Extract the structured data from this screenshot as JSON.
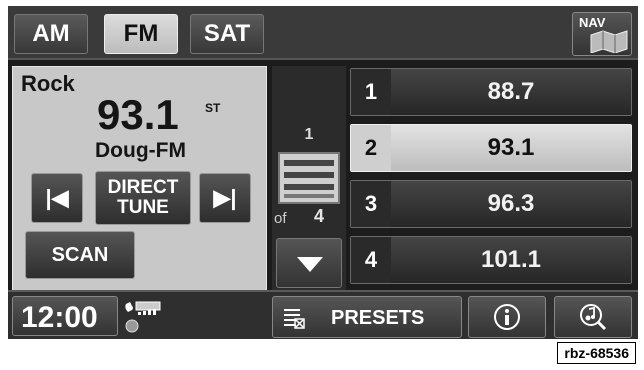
{
  "bands": [
    {
      "label": "AM",
      "active": false
    },
    {
      "label": "FM",
      "active": true
    },
    {
      "label": "SAT",
      "active": false
    }
  ],
  "nav": {
    "label": "NAV"
  },
  "station": {
    "genre": "Rock",
    "frequency": "93.1",
    "stereo": "ST",
    "callsign": "Doug-FM"
  },
  "controls": {
    "seek_back_glyph": "|◀",
    "direct_tune_line1": "DIRECT",
    "direct_tune_line2": "TUNE",
    "seek_forward_glyph": "▶|",
    "scan_label": "SCAN"
  },
  "pager": {
    "current_page": "1",
    "of_label": "of",
    "total_pages": "4"
  },
  "presets": [
    {
      "number": "1",
      "frequency": "88.7",
      "active": false
    },
    {
      "number": "2",
      "frequency": "93.1",
      "active": true
    },
    {
      "number": "3",
      "frequency": "96.3",
      "active": false
    },
    {
      "number": "4",
      "frequency": "101.1",
      "active": false
    }
  ],
  "bottom": {
    "clock": "12:00",
    "presets_label": "PRESETS",
    "info_icon": "info-icon",
    "music_search_icon": "music-search-icon"
  },
  "caption": "rbz-68536",
  "colors": {
    "active_button": "#c8c8c8",
    "panel_bg": "#1c1c1c",
    "text_light": "#ffffff"
  }
}
